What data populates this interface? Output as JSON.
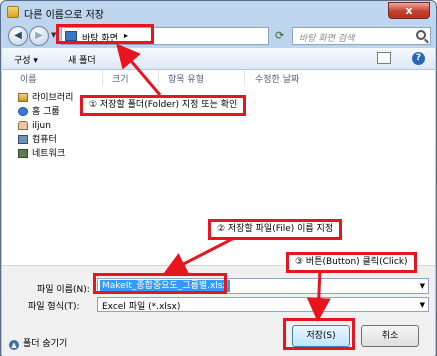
{
  "window": {
    "title": "다른 이름으로 저장",
    "close_label": "x"
  },
  "address": {
    "path": "바탕 화면",
    "path_arrow": "▸",
    "search_placeholder": "바탕 화면 검색"
  },
  "toolbar": {
    "organize": "구성 ▾",
    "new_folder": "새 폴더"
  },
  "columns": {
    "name": "이름",
    "size": "크기",
    "type": "항목 유형",
    "date": "수정한 날짜"
  },
  "tree": [
    {
      "label": "라이브러리",
      "icon": "library-icon"
    },
    {
      "label": "홈 그룹",
      "icon": "homegroup-icon"
    },
    {
      "label": "iljun",
      "icon": "user-icon"
    },
    {
      "label": "컴퓨터",
      "icon": "computer-icon"
    },
    {
      "label": "네트워크",
      "icon": "network-icon"
    }
  ],
  "form": {
    "filename_label": "파일 이름(N):",
    "filename_value": "MakeIt_종합중요도_그룹별.xlsx",
    "filetype_label": "파일 형식(T):",
    "filetype_value": "Excel 파일 (*.xlsx)",
    "hide_folders": "폴더 숨기기",
    "save_button": "저장(S)",
    "cancel_button": "취소"
  },
  "annotations": {
    "a1": "① 저장할 폴더(Folder) 지정 또는 확인",
    "a2": "② 저장할 파일(File) 이름 지정",
    "a3": "③ 버튼(Button) 클릭(Click)"
  },
  "colors": {
    "highlight": "#e8151e",
    "selection": "#3399ff"
  }
}
